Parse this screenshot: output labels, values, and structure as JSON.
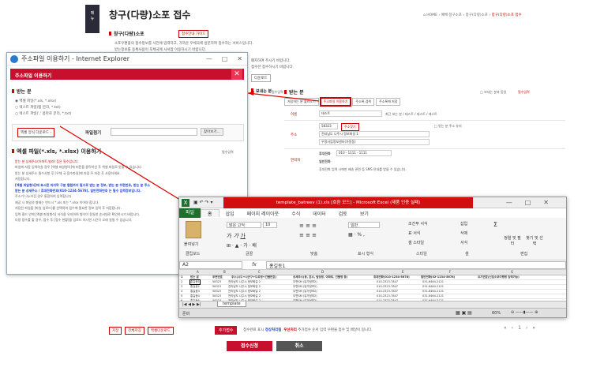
{
  "sidebar": {
    "tab_label_1": "메",
    "tab_label_2": "뉴"
  },
  "page": {
    "title": "창구(다량)소포 접수",
    "breadcrumb": [
      "HOME",
      "예체 창구소포",
      "창구(다량)소포",
      "창구(다량)소포 접수"
    ],
    "section_reception": "창구(다량)소포",
    "guide_button": "접수안내 가이드",
    "bullets": [
      "소포우편물의 접수정보를 사전에 입력하고, 가까운 우체국에 방문하여 접수하는 서비스입니다.",
      "받는정보를 등록사용이 포체국에 사서함 이용하시기 바랍니다."
    ],
    "bullets_right": [
      "폐지하여 주시기 바랍니다.",
      "접수한 접수하시기 바랍니다."
    ],
    "upload_btn_small": "다운로드",
    "sender_label": "보내는 분",
    "required_hint": "필수입력",
    "recipient_label": "받는 분",
    "recipient_opt1": "보내는 분과 동일",
    "recipient_opt2": "필수입력",
    "recipient_tabs": [
      "저장하는 분 불러오기",
      "주소파일 이용하기",
      "주소록 검색",
      "주소록에 저장"
    ],
    "form": {
      "name_label": "이름",
      "name_value": "테스트",
      "name_hint": "최근 보는 분 / 테스트 / 테스트 / 테스트",
      "addr_label": "주소",
      "zip": "58323",
      "zip_btn": "주소찾기",
      "addr_opt": "받는 분 주소 유지",
      "addr1": "전라남도 나주시 정보화길 1",
      "addr2": "우정사업정보센터(가정동)",
      "phone_label": "연락처",
      "mobile_label": "휴대전화",
      "mobile_value": "010  -  1111  -  1111",
      "tel_label": "일반전화",
      "tel_hint": "휴대전화 입력 시에만 배송 관련 등 SMS 안내를 받을 수 있습니다."
    },
    "bottom_buttons": [
      "저장",
      "전체저장",
      "엑셀다운로드"
    ],
    "bottom_red_btn": "추가접수",
    "bottom_note_a": "접수완료 표시",
    "bottom_note_b": "정상처리됨",
    "bottom_note_c": "우선처리",
    "bottom_note_d": "추가접수 순서 입력 우편물 접수 및 배달이 됩니다.",
    "pager": [
      "«",
      "‹",
      "1",
      "›",
      "»"
    ],
    "submit": "접수신청",
    "cancel": "취소"
  },
  "ie": {
    "title": "주소파일 이용하기 - Internet Explorer",
    "ctl": [
      "—",
      "□",
      "✕"
    ],
    "header": "주소파일 이용하기",
    "recipient_section": "받는 분",
    "options": [
      "엑셀 파일(*.xls, *.xlsx)",
      "텍스트 파일(탭 분리, *.txt)",
      "텍스트 파일(',' 콤마로 분리, *.txt)"
    ],
    "form_btn": "엑셀 양식 다운로드",
    "file_label": "파일첨기",
    "browse_btn": "찾아보기...",
    "excel_section": "엑셀 파일(*.xls, *.xlsx) 이용하기",
    "excel_required": "필수입력",
    "notes": [
      "받는 분 상세주소(아파트,빌라) 등은 필수입니다.",
      "파일에 저장 입력하실 경우 [엑셀 파일형식]에 버튼을 클릭하신 후 엑셀 파일로 받을 수 있습니다.",
      "받는 분 상세주소 필수사항 후 [우체 국 접수파일]에 저장 주 저장 후 사용하세요.",
      "저장합니다.",
      "[엑셀 파일형식]에 표시된 마지막 구분 컬럼까지 필수로 받는 분 정보, 받는 분 우편번호, 받는 분 주소",
      "받는 분 상세주소 / 휴대전화번호(010-1234-5678), 일반전화번호 는 필수 입력정보입니다.",
      "주소가 나누어진 경우 통합하여 입력합니다.",
      "제공 시 파일의 형태는 반드시 *.xls 또는 *.xlsx 이어야 합니다.",
      "저장된 파일을 [파일 업로드]를 선택하여 접수에 필요한 정보 입력 후 저장합니다.",
      "입력 필드 안에 [엑셀 파일형식] 서식을 유지하여 형식이 동일한 순서대로 확인하시기 바랍니다.",
      "다량 접수를 할 경우, 접수 후 [접수 현황]을 업로드 하시면 시간이 오래 걸릴 수 있습니다."
    ]
  },
  "excel": {
    "title": "template_batreev (1).xls [호환 모드] - Microsoft Excel (제품 인증 실패)",
    "tabs": [
      "파일",
      "홈",
      "삽입",
      "페이지 레이아웃",
      "수식",
      "데이터",
      "검토",
      "보기"
    ],
    "font_name": "맑은 고딕",
    "font_size": "10",
    "number_format": "일반",
    "groups": [
      "클립보드",
      "글꼴",
      "맞춤",
      "표시 형식",
      "스타일",
      "셀",
      "편집"
    ],
    "ribbon_items": [
      "붙여넣기",
      "조건부 서식",
      "표 서식",
      "셀 스타일",
      "삽입",
      "삭제",
      "서식",
      "정렬 및 필터",
      "찾기 및 선택"
    ],
    "name_box": "A2",
    "formula": "홍길동1",
    "fx": "fx",
    "col_letters": [
      "A",
      "B",
      "C",
      "D",
      "E",
      "F",
      "G"
    ],
    "headers": [
      "받는 분",
      "우편번호",
      "주소(시도+시군구+도로명+건물번호)",
      "상세주소(동, 호수, 빌딩명, 아파트, 건물명 등)",
      "휴대전화(010-1234-5678)",
      "일반전화(02-1234-5678)",
      "요기번호(신입소포이행명 입력가능)"
    ],
    "rows": [
      [
        "홍길동1",
        "58323",
        "전라남도 나주시 정보화길 2",
        "우편SM (유가정보2)",
        "010-2323-7847",
        "031-6464-2121"
      ],
      [
        "홍길동2",
        "58323",
        "전라남도 나주시 정보화길 2",
        "우편SM (유가정보2)",
        "010-2323-7847",
        "031-6464-2121"
      ],
      [
        "홍길동3",
        "58323",
        "전라남도 나주시 정보화길 2",
        "우편SM (유가정보2)",
        "010-2323-7847",
        "031-6464-2121"
      ],
      [
        "홍길동4",
        "58323",
        "전라남도 나주시 정보화길 2",
        "우편SM (유가정보2)",
        "010-2323-7847",
        "031-6464-2121"
      ],
      [
        "홍길동5",
        "58323",
        "전라남도 나주시 정보화길 2",
        "우편SM (유가정보2)",
        "010-2323-7847",
        "031-6464-2121"
      ]
    ],
    "row_numbers": [
      "1",
      "2",
      "3",
      "4",
      "5",
      "6"
    ],
    "sheet_tab": "template",
    "status": "준비",
    "zoom": "60%"
  },
  "colors": {
    "accent_red": "#c8102e",
    "excel_green": "#1f6f2e"
  },
  "icons": [
    "home-icon",
    "explorer-icon",
    "excel-icon",
    "paste-icon"
  ]
}
